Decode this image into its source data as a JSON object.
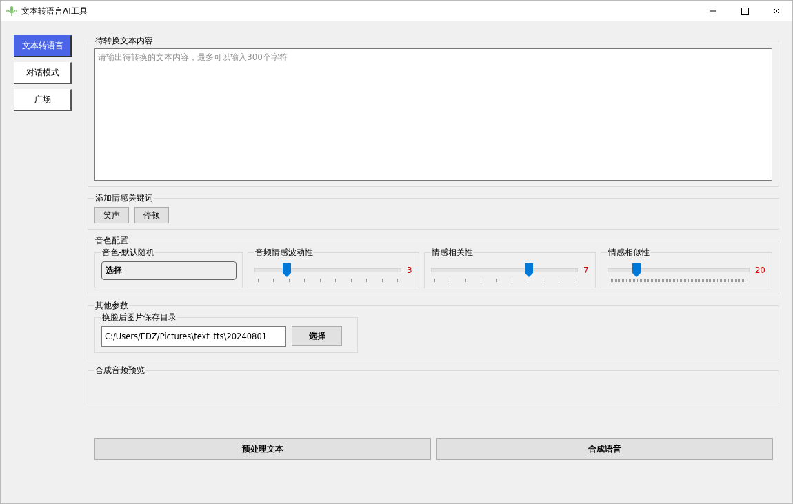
{
  "window": {
    "title": "文本转语言AI工具"
  },
  "nav": [
    {
      "label": "文本转语言",
      "selected": true
    },
    {
      "label": "对话模式",
      "selected": false
    },
    {
      "label": "广场",
      "selected": false
    }
  ],
  "text_group": {
    "title": "待转换文本内容",
    "placeholder": "请输出待转换的文本内容，最多可以输入300个字符"
  },
  "keyword_group": {
    "title": "添加情感关键词",
    "buttons": [
      "笑声",
      "停顿"
    ]
  },
  "voice_group": {
    "title": "音色配置",
    "voice": {
      "title": "音色-默认随机",
      "button": "选择"
    },
    "sliders": [
      {
        "title": "音频情感波动性",
        "level": 0.22,
        "reading": "3",
        "kind": "coarse"
      },
      {
        "title": "情感相关性",
        "level": 0.667,
        "reading": "7",
        "kind": "coarse"
      },
      {
        "title": "情感相似性",
        "level": 0.2,
        "reading": "20",
        "kind": "fine"
      }
    ]
  },
  "other_group": {
    "title": "其他参数",
    "dir": {
      "title": "换脸后图片保存目录",
      "value": "C:/Users/EDZ/Pictures\\text_tts\\20240801",
      "button": "选择"
    }
  },
  "preview_group": {
    "title": "合成音频预览"
  },
  "actions": [
    "预处理文本",
    "合成语音"
  ]
}
